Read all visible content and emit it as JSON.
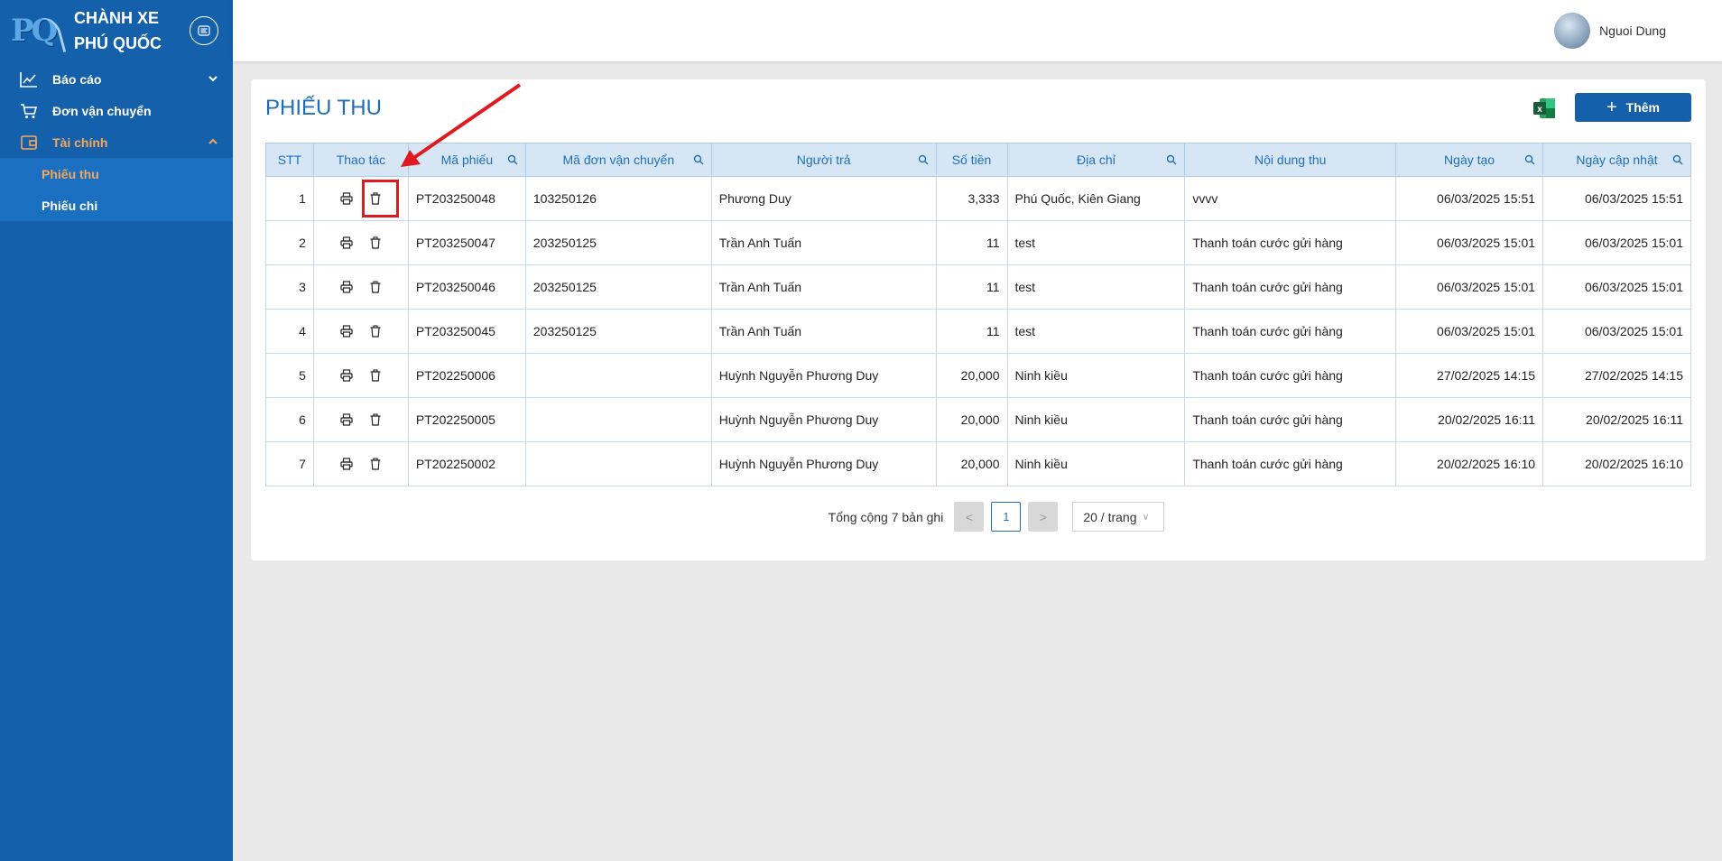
{
  "brand": {
    "logo": "PQ",
    "name_line1": "CHÀNH XE",
    "name_line2": "PHÚ QUỐC"
  },
  "sidebar": {
    "items": [
      {
        "label": "Báo cáo",
        "icon": "chart-line-icon"
      },
      {
        "label": "Đơn vận chuyển",
        "icon": "cart-icon"
      },
      {
        "label": "Tài chính",
        "icon": "finance-icon"
      }
    ],
    "submenu": [
      {
        "label": "Phiếu thu"
      },
      {
        "label": "Phiếu chi"
      }
    ]
  },
  "header": {
    "user_name": "Nguoi Dung"
  },
  "page": {
    "title": "PHIẾU THU",
    "add_label": "Thêm"
  },
  "table": {
    "headers": [
      "STT",
      "Thao tác",
      "Mã phiếu",
      "Mã đơn vận chuyển",
      "Người trả",
      "Số tiền",
      "Địa chỉ",
      "Nội dung thu",
      "Ngày tạo",
      "Ngày cập nhật"
    ],
    "rows": [
      {
        "stt": "1",
        "code": "PT203250048",
        "order": "103250126",
        "payer": "Phương Duy",
        "amount": "3,333",
        "address": "Phú Quốc, Kiên Giang",
        "content": "vvvv",
        "created": "06/03/2025 15:51",
        "updated": "06/03/2025 15:51"
      },
      {
        "stt": "2",
        "code": "PT203250047",
        "order": "203250125",
        "payer": "Trần Anh Tuấn",
        "amount": "11",
        "address": "test",
        "content": "Thanh toán cước gửi hàng",
        "created": "06/03/2025 15:01",
        "updated": "06/03/2025 15:01"
      },
      {
        "stt": "3",
        "code": "PT203250046",
        "order": "203250125",
        "payer": "Trần Anh Tuấn",
        "amount": "11",
        "address": "test",
        "content": "Thanh toán cước gửi hàng",
        "created": "06/03/2025 15:01",
        "updated": "06/03/2025 15:01"
      },
      {
        "stt": "4",
        "code": "PT203250045",
        "order": "203250125",
        "payer": "Trần Anh Tuấn",
        "amount": "11",
        "address": "test",
        "content": "Thanh toán cước gửi hàng",
        "created": "06/03/2025 15:01",
        "updated": "06/03/2025 15:01"
      },
      {
        "stt": "5",
        "code": "PT202250006",
        "order": "",
        "payer": "Huỳnh Nguyễn Phương Duy",
        "amount": "20,000",
        "address": "Ninh kiều",
        "content": "Thanh toán cước gửi hàng",
        "created": "27/02/2025 14:15",
        "updated": "27/02/2025 14:15"
      },
      {
        "stt": "6",
        "code": "PT202250005",
        "order": "",
        "payer": "Huỳnh Nguyễn Phương Duy",
        "amount": "20,000",
        "address": "Ninh kiều",
        "content": "Thanh toán cước gửi hàng",
        "created": "20/02/2025 16:11",
        "updated": "20/02/2025 16:11"
      },
      {
        "stt": "7",
        "code": "PT202250002",
        "order": "",
        "payer": "Huỳnh Nguyễn Phương Duy",
        "amount": "20,000",
        "address": "Ninh kiều",
        "content": "Thanh toán cước gửi hàng",
        "created": "20/02/2025 16:10",
        "updated": "20/02/2025 16:10"
      }
    ]
  },
  "pagination": {
    "total_text": "Tổng cộng 7 bản ghi",
    "prev": "<",
    "current": "1",
    "next": ">",
    "page_size": "20 / trang"
  },
  "colors": {
    "sidebar": "#1460aa",
    "accent": "#f5a75c",
    "primary": "#1f6fb8",
    "highlight": "#e0191f"
  }
}
